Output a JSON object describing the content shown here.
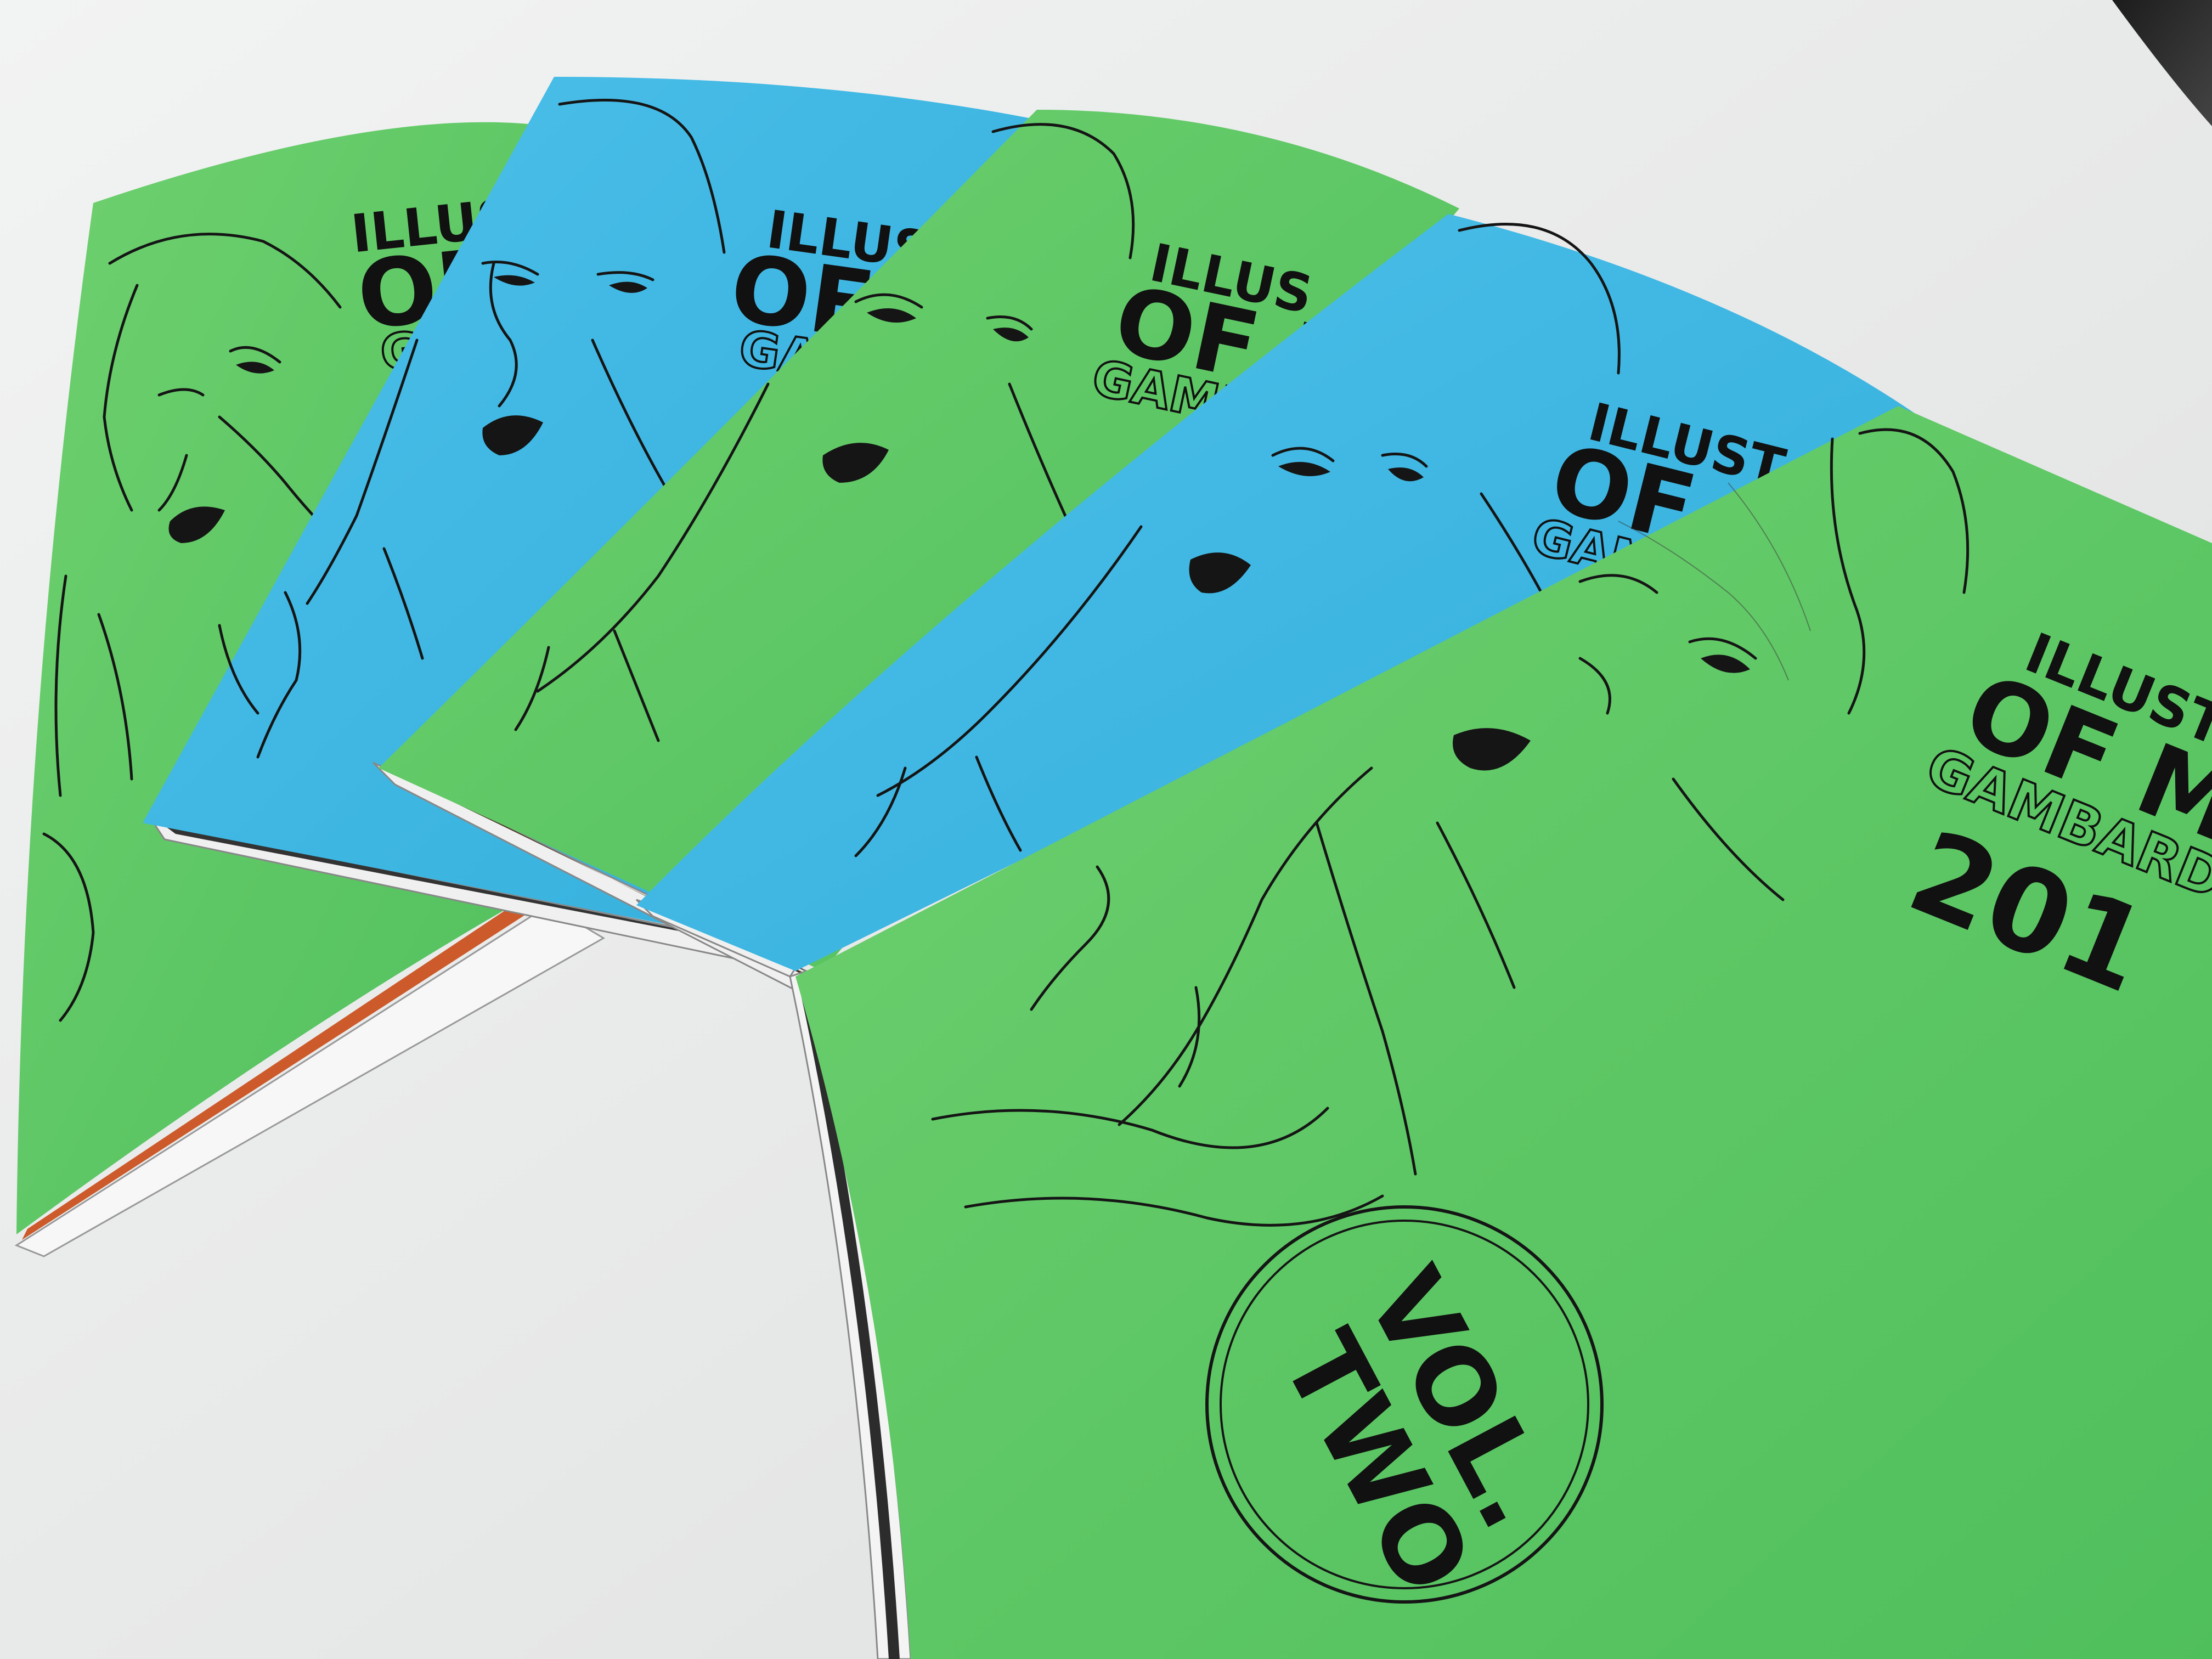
{
  "scene": {
    "description_free": true,
    "colors": {
      "table": "#e8e9e9",
      "green_cover": "#5dc766",
      "blue_cover": "#3fb6e0",
      "ink": "#151515"
    }
  },
  "covers": [
    {
      "color": "green",
      "title_line1": "ILLUST",
      "title_line2": "OF",
      "title_line3": "GAM"
    },
    {
      "color": "blue",
      "title_line1": "ILLUSTR",
      "title_line2": "OF",
      "title_line3": "GAM"
    },
    {
      "color": "green",
      "title_line1": "ILLUS",
      "title_line2": "OF M",
      "title_line3": "GAMB"
    },
    {
      "color": "blue",
      "title_line1": "ILLUST",
      "title_line2": "OF",
      "title_line3": "GAM"
    },
    {
      "color": "green",
      "title_line1": "ILLUSTR",
      "title_line2": "OF MA",
      "title_line3": "GAMBARDE",
      "year": "201",
      "badge_line1": "VOL.",
      "badge_line2": "TWO"
    }
  ]
}
